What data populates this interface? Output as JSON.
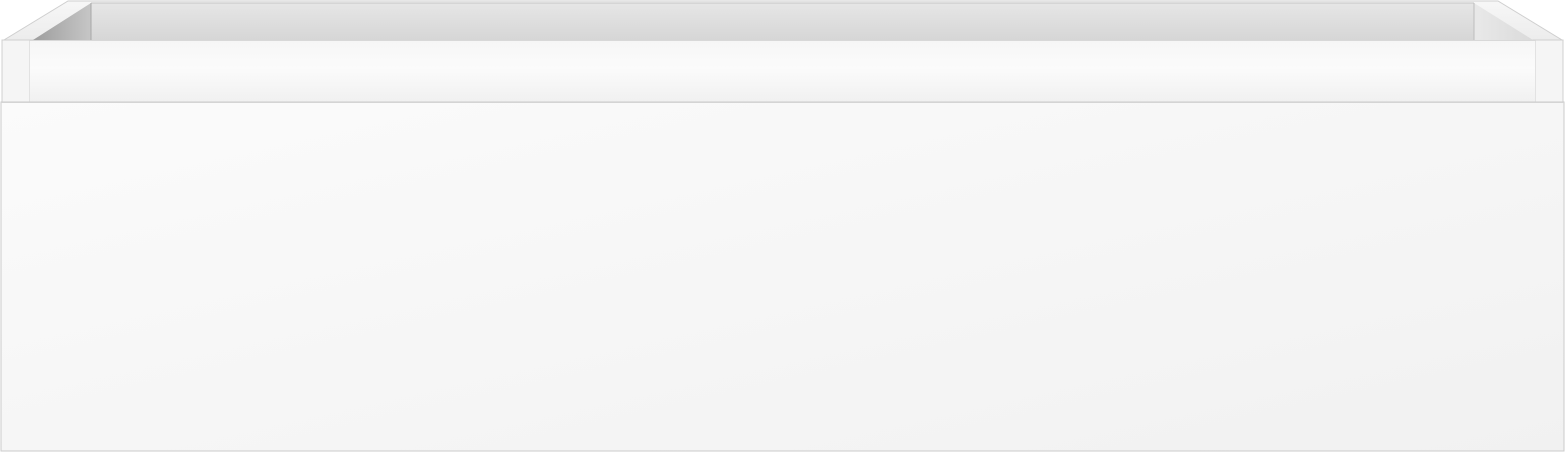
{
  "object": {
    "type": "drawer",
    "view": "front-perspective",
    "colors": {
      "background": "#ffffff",
      "front_panel_light": "#fafafa",
      "front_panel_dark": "#f2f2f2",
      "interior_back": "#dcdcdc",
      "interior_left_wall": "#b5b5b5",
      "interior_right_wall": "#e4e4e4",
      "rim": "#f3f3f3",
      "edge_line": "#c8c8c8"
    }
  }
}
